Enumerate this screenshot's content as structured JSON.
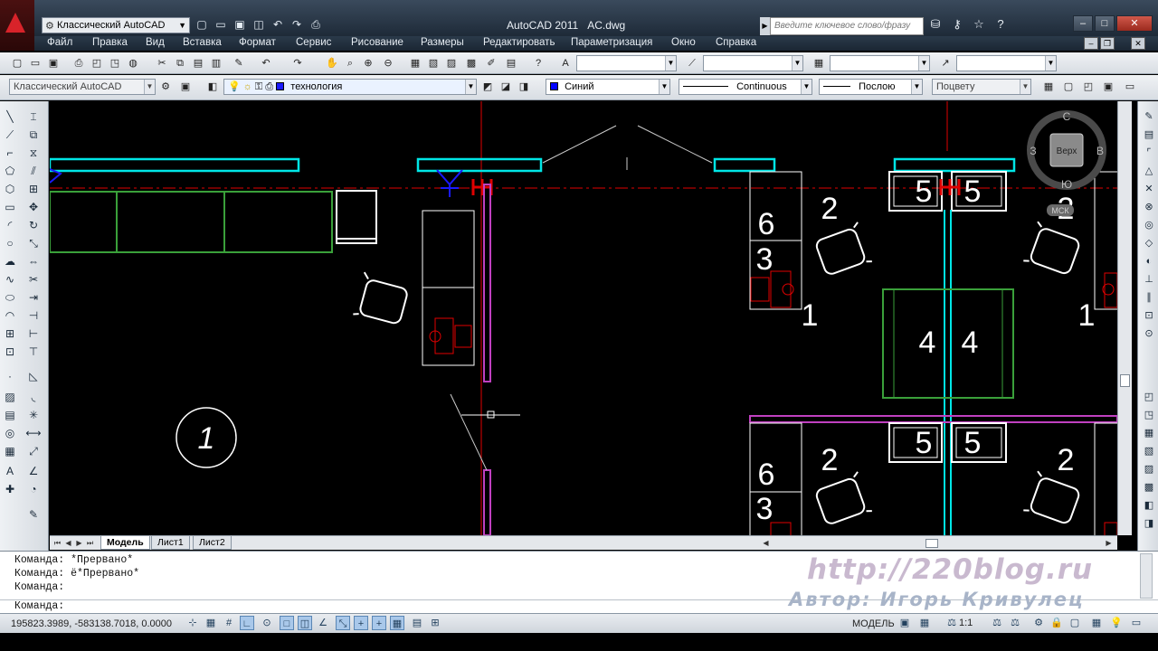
{
  "titlebar": {
    "workspace": "Классический AutoCAD",
    "title": "AutoCAD 2011",
    "filename": "AC.dwg",
    "search_placeholder": "Введите ключевое слово/фразу",
    "qat_icons": [
      "new-icon",
      "open-icon",
      "save-icon",
      "saveas-icon",
      "undo-icon",
      "redo-icon",
      "plot-icon"
    ],
    "right_icons": [
      "binoculars-icon",
      "key-icon",
      "star-icon",
      "help-icon"
    ],
    "window_controls": [
      "minimize",
      "maximize",
      "close"
    ]
  },
  "menu": {
    "items": [
      "Файл",
      "Правка",
      "Вид",
      "Вставка",
      "Формат",
      "Сервис",
      "Рисование",
      "Размеры",
      "Редактировать",
      "Параметризация",
      "Окно",
      "Справка"
    ]
  },
  "toolbar2": {
    "workspace": "Классический AutoCAD",
    "layer": "технология",
    "color": "Синий",
    "linetype": "Continuous",
    "lineweight": "Послою",
    "plotstyle": "Поцвету"
  },
  "viewcube": {
    "north": "С",
    "south": "Ю",
    "west": "З",
    "east": "В",
    "face": "Верх",
    "wcs": "МСК"
  },
  "drawing": {
    "labels": {
      "n1": "1",
      "n2": "2",
      "n3": "3",
      "n4": "4",
      "n5": "5",
      "n6": "6"
    }
  },
  "layout_tabs": {
    "items": [
      "Модель",
      "Лист1",
      "Лист2"
    ],
    "active": "Модель"
  },
  "command": {
    "lines": [
      "Команда: *Прервано*",
      "Команда: ё*Прервано*",
      "Команда:"
    ],
    "prompt": "Команда:"
  },
  "watermark": {
    "url": "http://220blog.ru",
    "author": "Автор: Игорь Кривулец"
  },
  "status": {
    "coords": "195823.3989, -583138.7018, 0.0000",
    "space": "МОДЕЛЬ",
    "scale": "1:1"
  },
  "colors": {
    "cyan": "#00e6e6",
    "green": "#3aa03a",
    "magenta": "#c040c0",
    "red": "#e00000",
    "blue": "#1a1aff",
    "white": "#ffffff"
  }
}
